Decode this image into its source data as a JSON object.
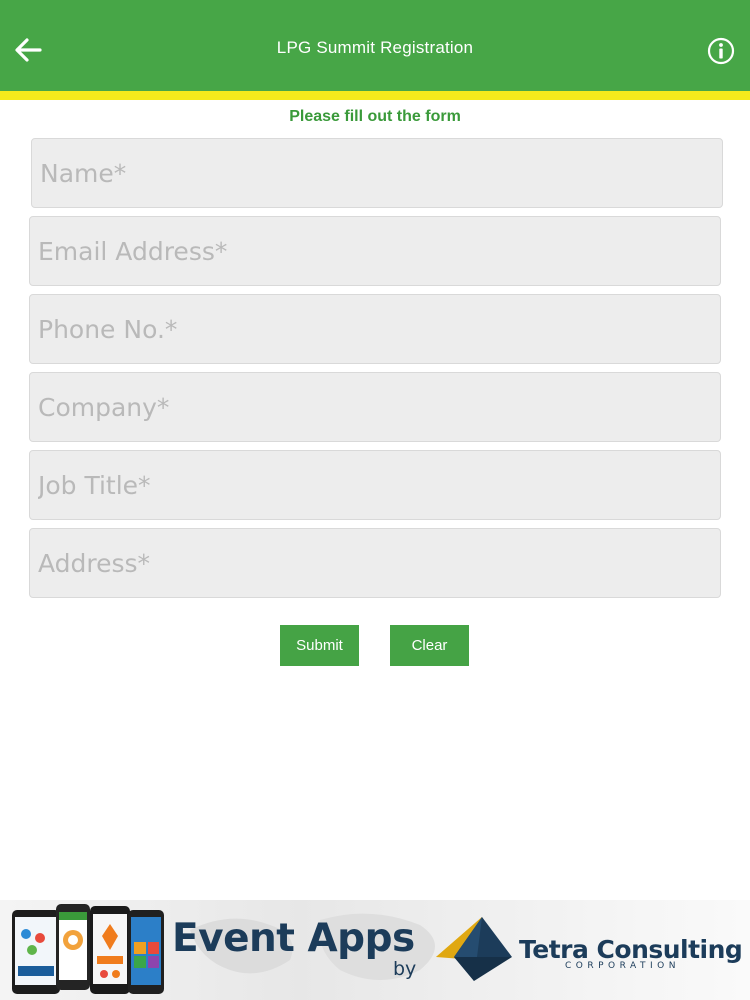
{
  "header": {
    "title": "LPG Summit Registration",
    "back_icon": "arrow-left-icon",
    "info_icon": "info-circle-icon",
    "bg_color": "#47a647",
    "stripe_color": "#f3ea1c"
  },
  "form": {
    "subtitle": "Please fill out the form",
    "fields": {
      "name": {
        "placeholder": "Name*",
        "value": ""
      },
      "email": {
        "placeholder": "Email Address*",
        "value": ""
      },
      "phone": {
        "placeholder": "Phone No.*",
        "value": ""
      },
      "company": {
        "placeholder": "Company*",
        "value": ""
      },
      "job_title": {
        "placeholder": "Job Title*",
        "value": ""
      },
      "address": {
        "placeholder": "Address*",
        "value": ""
      }
    },
    "submit_label": "Submit",
    "clear_label": "Clear"
  },
  "footer": {
    "event_apps": "Event Apps",
    "by": "by",
    "company_name": "Tetra Consulting",
    "company_sub": "CORPORATION",
    "logo_text": "Tetra Consulting"
  }
}
